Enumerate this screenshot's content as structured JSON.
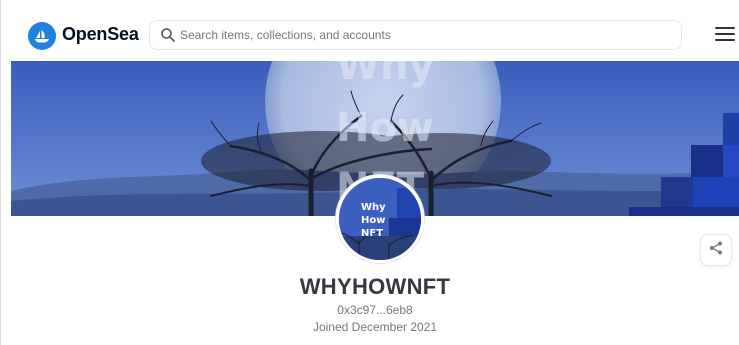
{
  "header": {
    "brand": "OpenSea",
    "search_placeholder": "Search items, collections, and accounts"
  },
  "banner": {
    "overlay_text": [
      "Why",
      "How",
      "NFT"
    ]
  },
  "avatar": {
    "lines": [
      "Why",
      "How",
      "NFT"
    ]
  },
  "profile": {
    "name": "WHYHOWNFT",
    "wallet": "0x3c97...6eb8",
    "joined": "Joined December 2021"
  },
  "icons": {
    "logo": "opensea-logo-icon",
    "search": "search-icon",
    "menu": "hamburger-menu-icon",
    "share": "share-icon"
  },
  "colors": {
    "brand_blue": "#2081e2",
    "banner_sky": "#4a6bc4",
    "text_dark": "#353840",
    "text_muted": "#707a83"
  }
}
